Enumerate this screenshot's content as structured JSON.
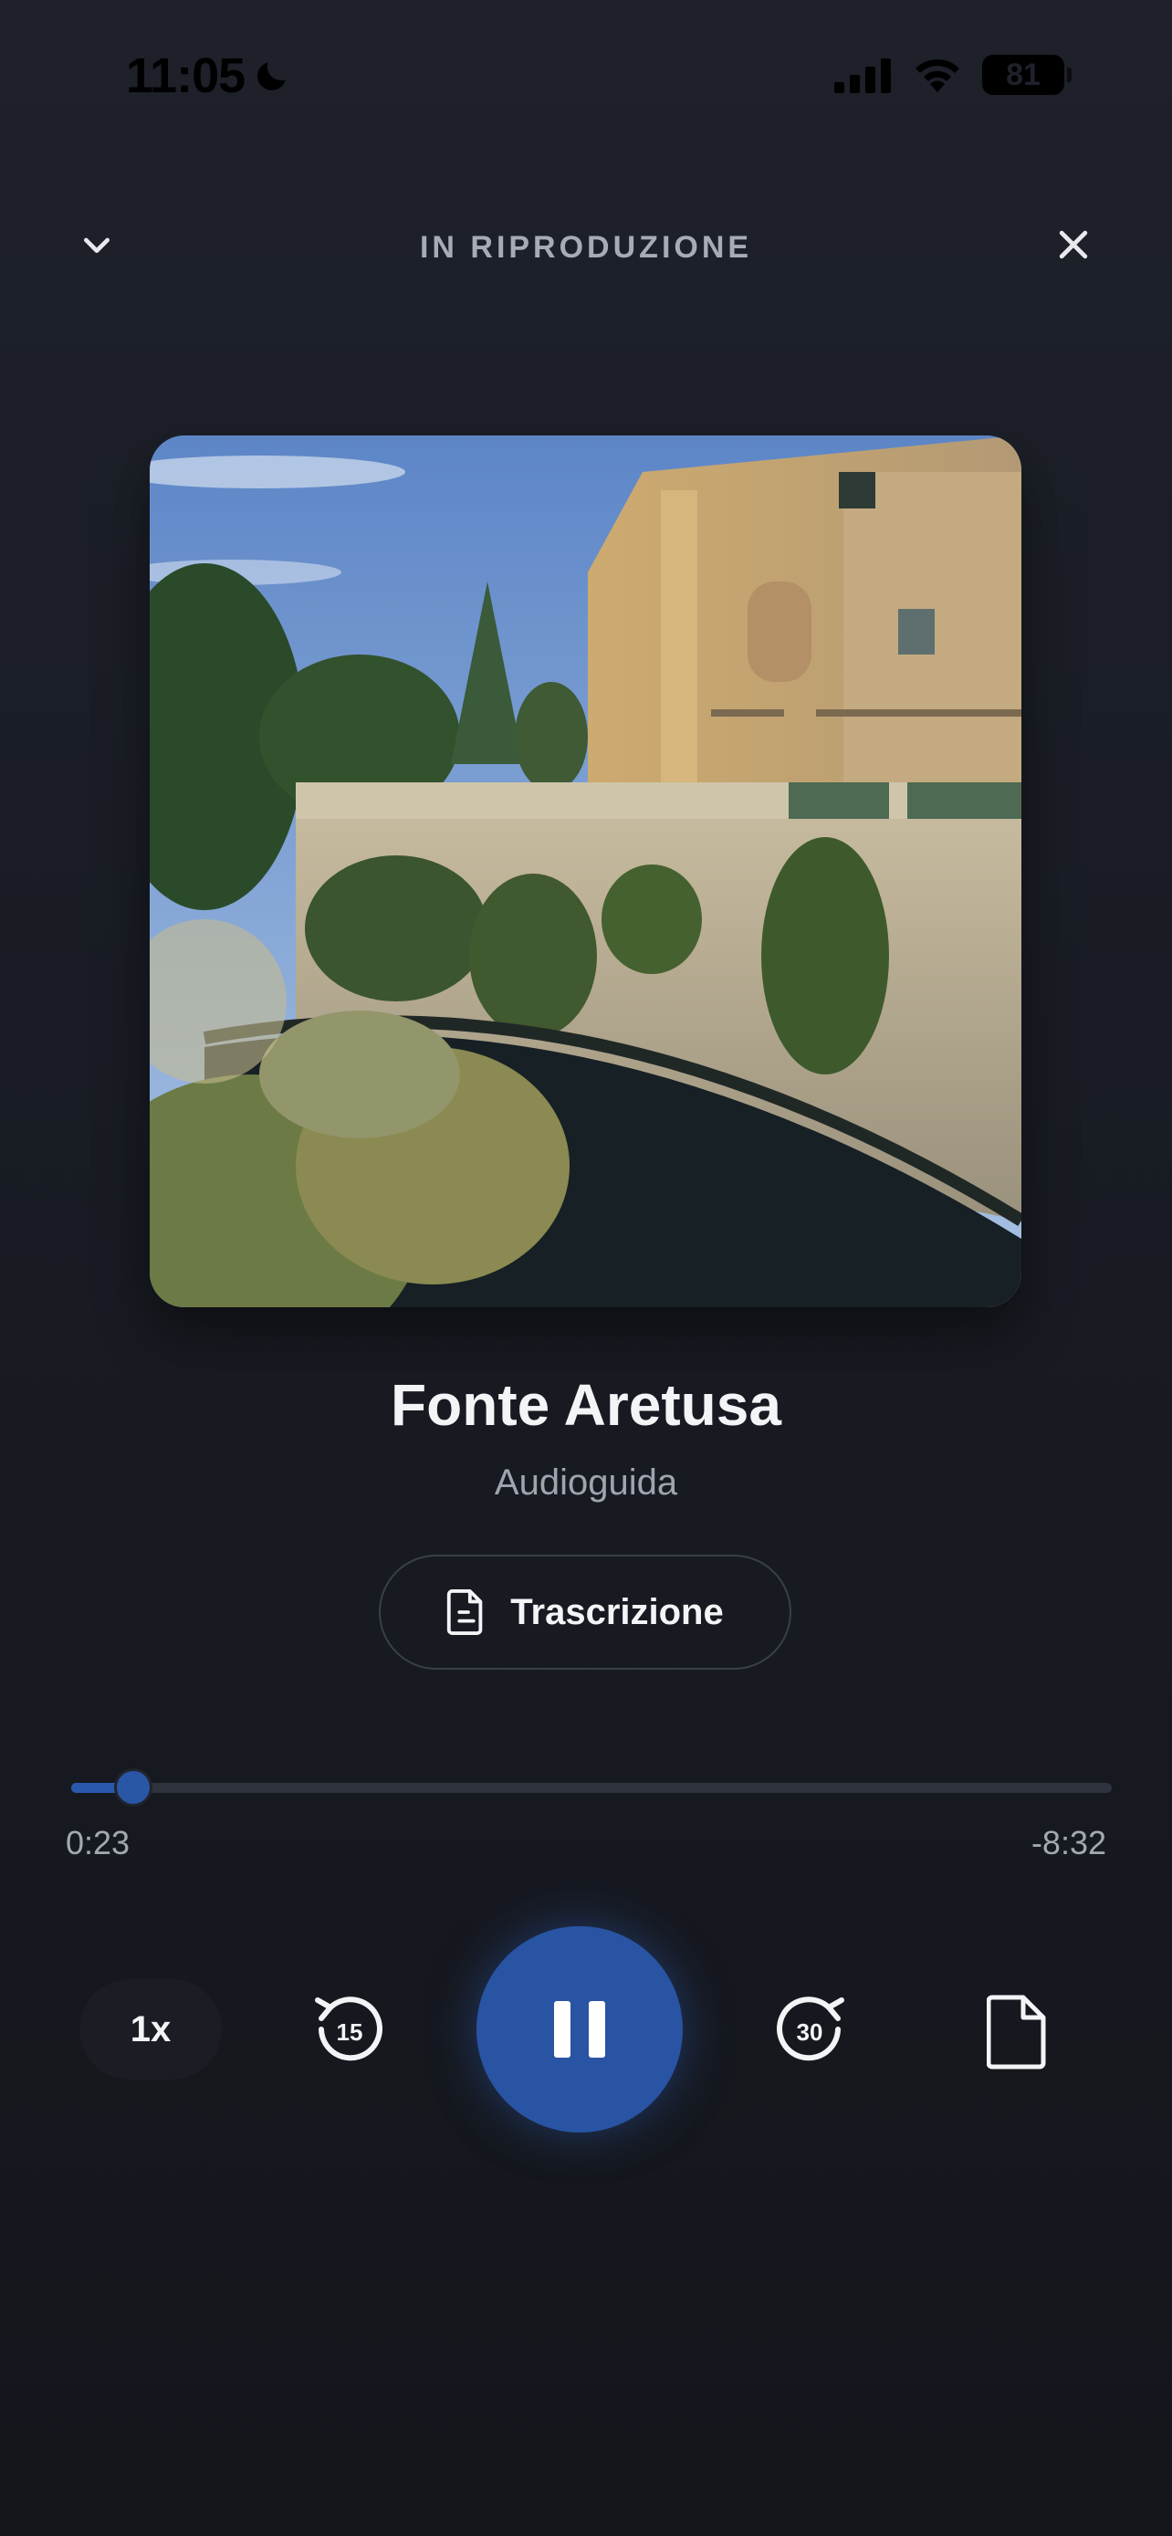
{
  "status_bar": {
    "time": "11:05",
    "battery": "81",
    "icons": [
      "moon-icon",
      "signal-icon",
      "wifi-icon",
      "battery-icon"
    ]
  },
  "header": {
    "title": "IN RIPRODUZIONE",
    "left_icon": "chevron-down-icon",
    "right_icon": "close-icon"
  },
  "track": {
    "title": "Fonte Aretusa",
    "subtitle": "Audioguida"
  },
  "transcript_button": {
    "label": "Trascrizione",
    "icon": "document-icon"
  },
  "progress": {
    "elapsed": "0:23",
    "remaining": "-8:32",
    "fraction": 0.0595
  },
  "controls": {
    "speed": "1x",
    "rewind_icon": "rewind-15-icon",
    "rewind_label": "15",
    "play_state_icon": "pause-icon",
    "forward_icon": "forward-30-icon",
    "forward_label": "30",
    "extra_icon": "file-icon"
  },
  "colors": {
    "accent": "#2954a3",
    "background": "#1b1e26",
    "secondary_text": "#a4a8b2"
  }
}
